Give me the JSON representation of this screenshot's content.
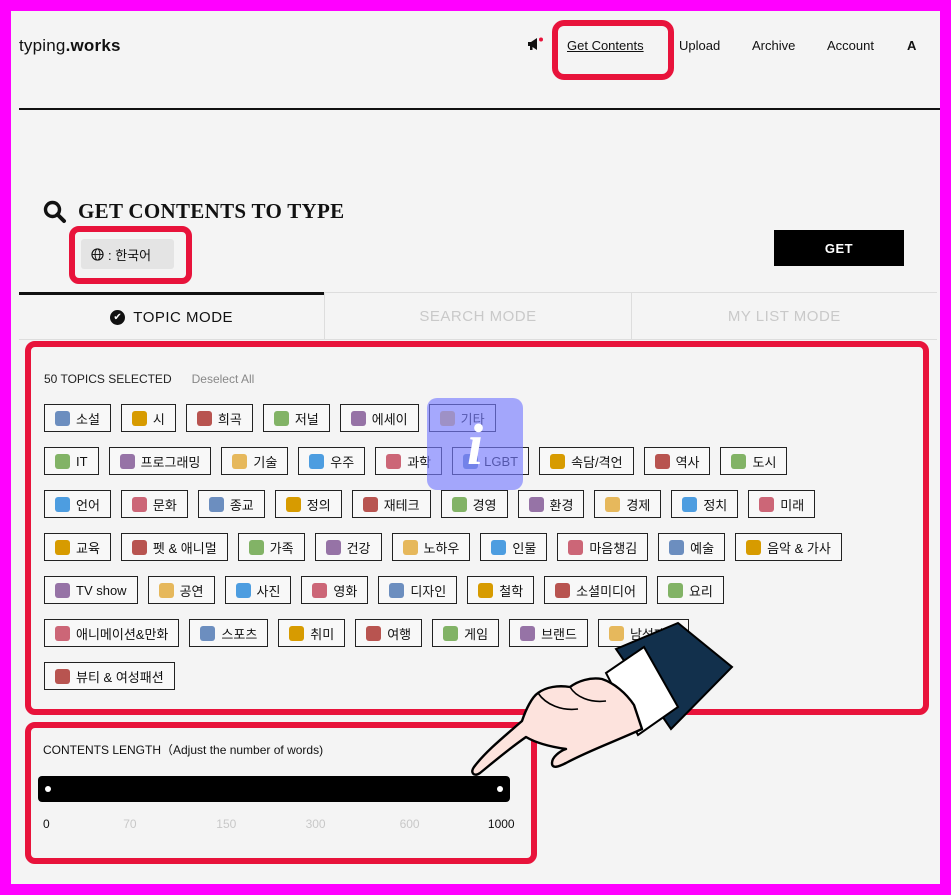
{
  "header": {
    "logo_prefix": "typing",
    "logo_suffix": ".works",
    "nav": {
      "announcement_icon": "megaphone-icon",
      "get_contents": "Get Contents",
      "upload": "Upload",
      "archive": "Archive",
      "account": "Account",
      "language_short": "A"
    }
  },
  "main": {
    "title": "GET CONTENTS TO TYPE",
    "language_value": ": 한국어",
    "get_button": "GET",
    "tabs": [
      {
        "label": "TOPIC MODE",
        "active": true
      },
      {
        "label": "SEARCH MODE",
        "active": false
      },
      {
        "label": "MY LIST MODE",
        "active": false
      }
    ],
    "topics_selected": "50 TOPICS SELECTED",
    "deselect_all": "Deselect All",
    "topic_rows": [
      [
        "소설",
        "시",
        "희곡",
        "저널",
        "에세이",
        "기타"
      ],
      [
        "IT",
        "프로그래밍",
        "기술",
        "우주",
        "과학",
        "LGBT",
        "속담/격언",
        "역사",
        "도시"
      ],
      [
        "언어",
        "문화",
        "종교",
        "정의",
        "재테크",
        "경영",
        "환경",
        "경제",
        "정치",
        "미래"
      ],
      [
        "교육",
        "펫 & 애니멀",
        "가족",
        "건강",
        "노하우",
        "인물",
        "마음챙김",
        "예술",
        "음악 & 가사"
      ],
      [
        "TV show",
        "공연",
        "사진",
        "영화",
        "디자인",
        "철학",
        "소셜미디어",
        "요리"
      ],
      [
        "애니메이션&만화",
        "스포츠",
        "취미",
        "여행",
        "게임",
        "브랜드",
        "남성패션"
      ],
      [
        "뷰티 & 여성패션"
      ]
    ],
    "contents_length": {
      "label": "CONTENTS LENGTH（Adjust the number of words)",
      "ticks": [
        "0",
        "70",
        "150",
        "300",
        "600",
        "1000"
      ],
      "selected_min": "0",
      "selected_max": "1000"
    },
    "overlay_glyph": "i"
  },
  "colors": {
    "frame": "#ff00ff",
    "highlight": "#e8133b",
    "overlay": "#787dff"
  }
}
